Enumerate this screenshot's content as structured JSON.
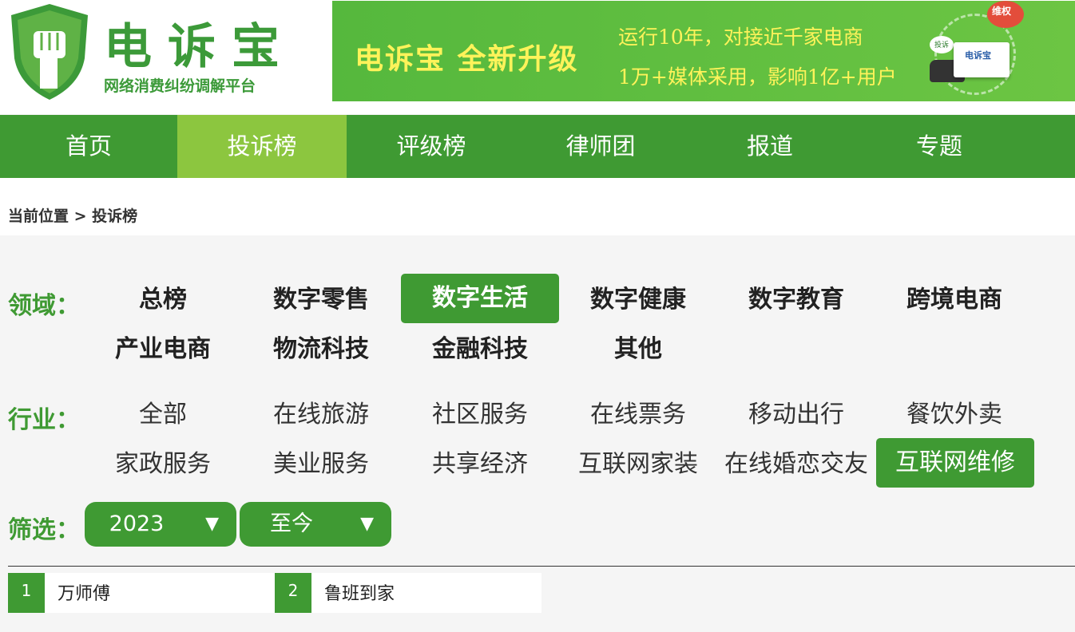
{
  "logo": {
    "title": "电诉宝",
    "subtitle": "网络消费纠纷调解平台"
  },
  "banner": {
    "headline": "电诉宝 全新升级",
    "line1": "运行10年，对接近千家电商",
    "line2": "1万+媒体采用，影响1亿+用户",
    "badge": "维权",
    "card_text": "电诉宝",
    "small_text": "投诉"
  },
  "nav": {
    "items": [
      {
        "label": "首页"
      },
      {
        "label": "投诉榜"
      },
      {
        "label": "评级榜"
      },
      {
        "label": "律师团"
      },
      {
        "label": "报道"
      },
      {
        "label": "专题"
      }
    ],
    "active_index": 1
  },
  "breadcrumb": {
    "text": "当前位置 > 投诉榜"
  },
  "domain": {
    "label": "领域：",
    "tags": [
      {
        "label": "总榜"
      },
      {
        "label": "数字零售"
      },
      {
        "label": "数字生活"
      },
      {
        "label": "数字健康"
      },
      {
        "label": "数字教育"
      },
      {
        "label": "跨境电商"
      },
      {
        "label": "产业电商"
      },
      {
        "label": "物流科技"
      },
      {
        "label": "金融科技"
      },
      {
        "label": "其他"
      }
    ],
    "selected": "数字生活"
  },
  "industry": {
    "label": "行业：",
    "tags": [
      {
        "label": "全部"
      },
      {
        "label": "在线旅游"
      },
      {
        "label": "社区服务"
      },
      {
        "label": "在线票务"
      },
      {
        "label": "移动出行"
      },
      {
        "label": "餐饮外卖"
      },
      {
        "label": "家政服务"
      },
      {
        "label": "美业服务"
      },
      {
        "label": "共享经济"
      },
      {
        "label": "互联网家装"
      },
      {
        "label": "在线婚恋交友"
      },
      {
        "label": "互联网维修"
      }
    ],
    "selected": "互联网维修"
  },
  "filter": {
    "label": "筛选：",
    "year_value": "2023",
    "range_value": "至今",
    "arrow": "▼"
  },
  "results": [
    {
      "rank": "1",
      "name": "万师傅"
    },
    {
      "rank": "2",
      "name": "鲁班到家"
    }
  ],
  "colors": {
    "primary_green": "#3f9a33",
    "active_tab_green": "#8cc63f",
    "banner_text_yellow": "#fff35a"
  }
}
